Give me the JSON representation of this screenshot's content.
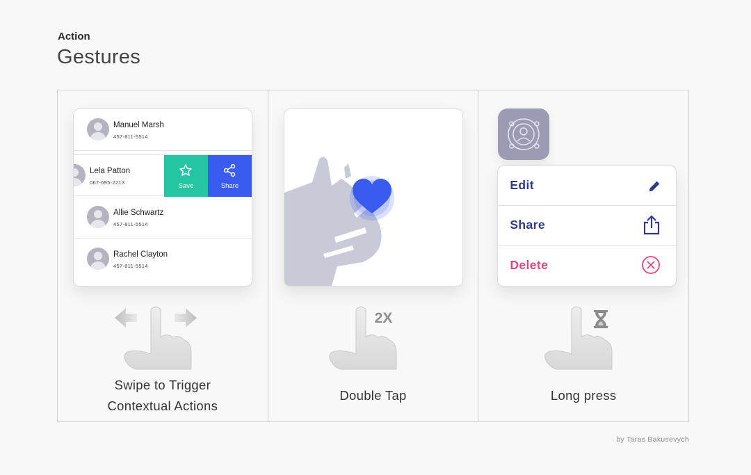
{
  "header": {
    "eyebrow": "Action",
    "title": "Gestures"
  },
  "panels": {
    "swipe": {
      "caption_line1": "Swipe to Trigger",
      "caption_line2": "Contextual Actions",
      "contacts": [
        {
          "name": "Manuel Marsh",
          "phone": "457-811-5514"
        },
        {
          "name": "Lela Patton",
          "phone": "067-695-2213"
        },
        {
          "name": "Allie Schwartz",
          "phone": "457-811-5514"
        },
        {
          "name": "Rachel Clayton",
          "phone": "457-811-5514"
        }
      ],
      "actions": {
        "save": "Save",
        "share": "Share"
      },
      "colors": {
        "save": "#25c5a4",
        "share": "#3a5bf0"
      }
    },
    "double_tap": {
      "caption": "Double Tap",
      "tap_count": "2X",
      "colors": {
        "heart": "#3a5bf0"
      }
    },
    "long_press": {
      "caption": "Long press",
      "menu": [
        {
          "label": "Edit",
          "icon": "pencil-icon"
        },
        {
          "label": "Share",
          "icon": "share-upload-icon"
        },
        {
          "label": "Delete",
          "icon": "close-circle-icon"
        }
      ],
      "colors": {
        "menu_text": "#2e3a8a",
        "delete": "#e0457b"
      }
    }
  },
  "credit": "by Taras Bakusevych"
}
